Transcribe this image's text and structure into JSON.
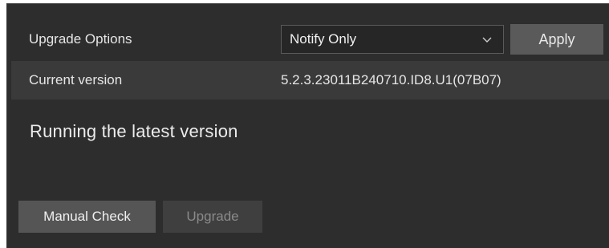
{
  "upgrade_options": {
    "label": "Upgrade Options",
    "selected": "Notify Only",
    "apply_label": "Apply"
  },
  "current_version": {
    "label": "Current version",
    "value": "5.2.3.23011B240710.ID8.U1(07B07)"
  },
  "status": {
    "text": "Running the latest version"
  },
  "actions": {
    "manual_check_label": "Manual Check",
    "upgrade_label": "Upgrade",
    "upgrade_enabled": false
  },
  "icons": {
    "dropdown": "chevron-down-icon"
  },
  "colors": {
    "panel_bg": "#2d2d2d",
    "row_highlight": "#3a3a3a",
    "button_bg": "#555555",
    "button_disabled_bg": "#3f3f3f",
    "text": "#e6e6e6",
    "text_disabled": "#8a8a8a"
  }
}
